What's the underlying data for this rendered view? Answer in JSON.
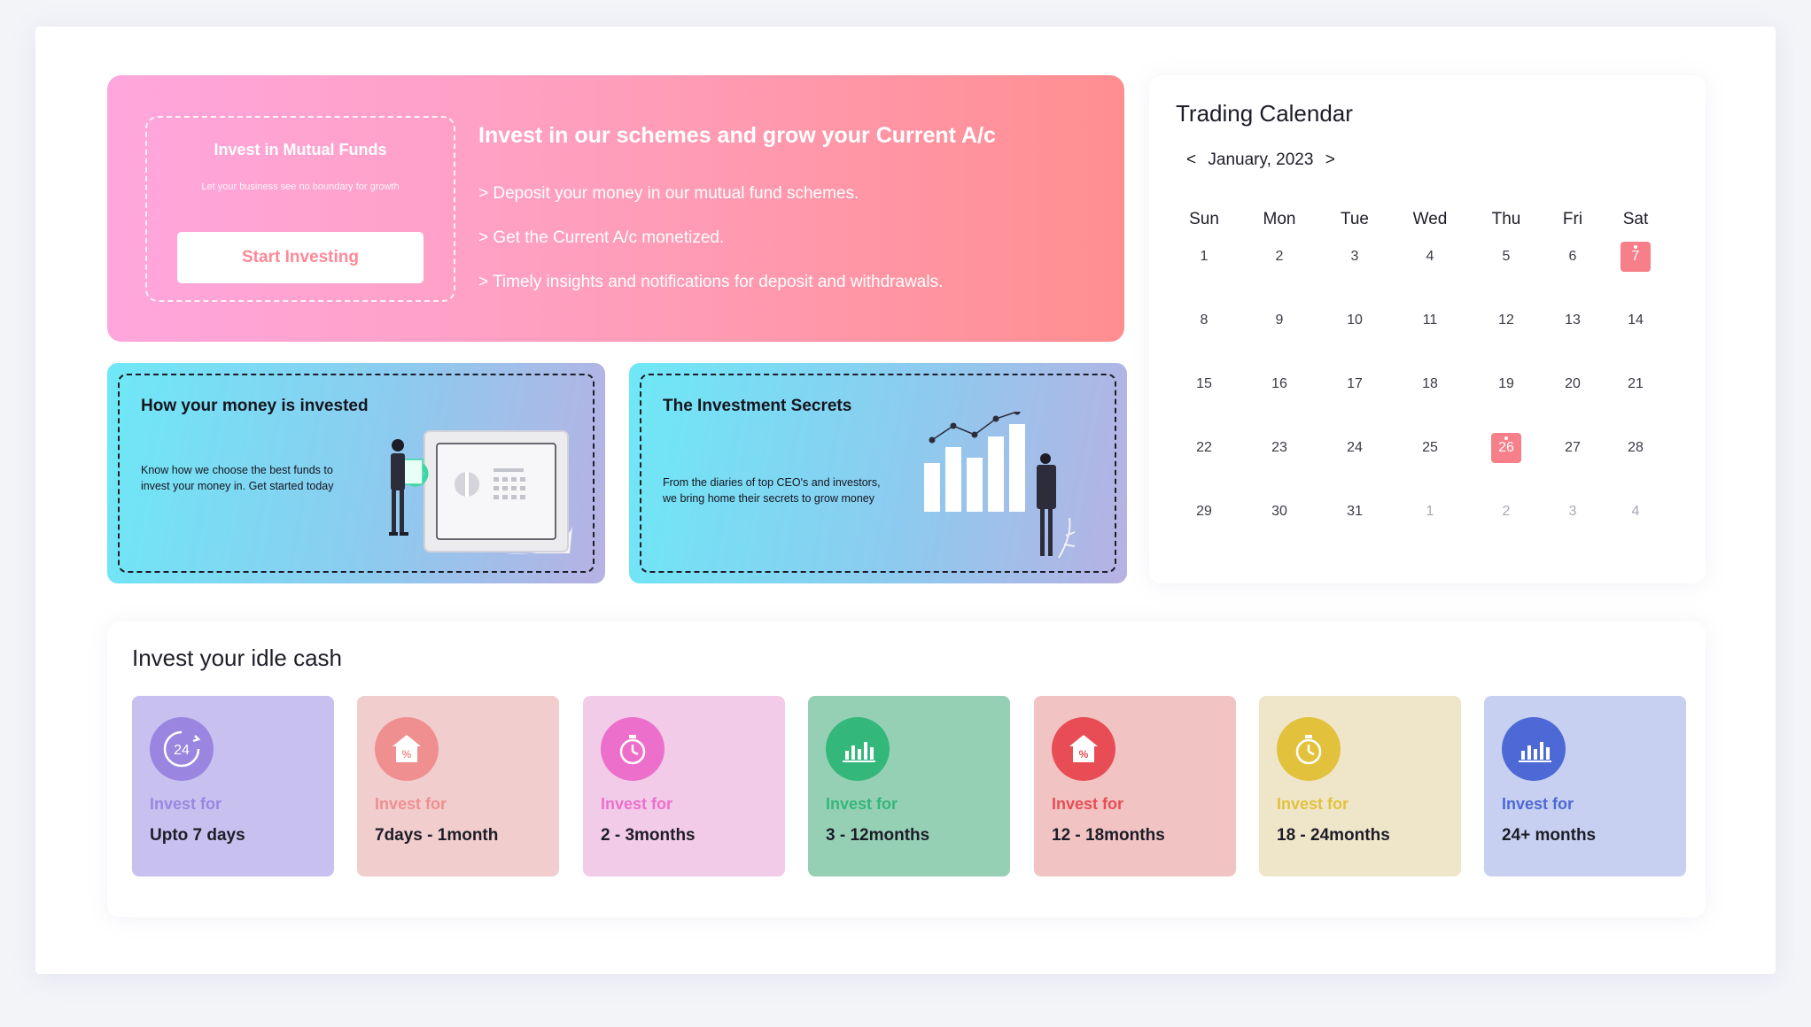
{
  "hero": {
    "box_title": "Invest in Mutual Funds",
    "box_sub": "Let your business see no boundary for growth",
    "cta": "Start Investing",
    "heading": "Invest in our schemes and grow your Current A/c",
    "bullets": [
      "> Deposit your money in our mutual fund schemes.",
      "> Get the Current A/c monetized.",
      "> Timely insights and notifications for deposit and withdrawals."
    ]
  },
  "cards": [
    {
      "title": "How your money is invested",
      "desc": "Know how we choose the best funds to invest your money in. Get started today"
    },
    {
      "title": "The Investment Secrets",
      "desc": "From the diaries of top CEO's and investors, we bring home their secrets to grow money"
    }
  ],
  "calendar": {
    "title": "Trading Calendar",
    "prev": "<",
    "next": ">",
    "month": "January, 2023",
    "weekdays": [
      "Sun",
      "Mon",
      "Tue",
      "Wed",
      "Thu",
      "Fri",
      "Sat"
    ],
    "weeks": [
      [
        "1",
        "2",
        "3",
        "4",
        "5",
        "6",
        "7"
      ],
      [
        "8",
        "9",
        "10",
        "11",
        "12",
        "13",
        "14"
      ],
      [
        "15",
        "16",
        "17",
        "18",
        "19",
        "20",
        "21"
      ],
      [
        "22",
        "23",
        "24",
        "25",
        "26",
        "27",
        "28"
      ],
      [
        "29",
        "30",
        "31",
        "1",
        "2",
        "3",
        "4"
      ]
    ]
  },
  "idle": {
    "title": "Invest your idle cash",
    "tiles": [
      {
        "label": "Invest for",
        "value": "Upto 7 days",
        "icon": "24-hours-icon",
        "accent": "#9a86e0",
        "bg": "#c8c1f0"
      },
      {
        "label": "Invest for",
        "value": "7days - 1month",
        "icon": "percent-house-icon",
        "accent": "#f08f8f",
        "bg": "#f1cdcd"
      },
      {
        "label": "Invest for",
        "value": "2 - 3months",
        "icon": "stopwatch-icon",
        "accent": "#ec6fcb",
        "bg": "#f2cbe8"
      },
      {
        "label": "Invest for",
        "value": "3 - 12months",
        "icon": "bar-chart-icon",
        "accent": "#33b77a",
        "bg": "#96d0b4"
      },
      {
        "label": "Invest for",
        "value": "12 - 18months",
        "icon": "percent-house-icon",
        "accent": "#e84d55",
        "bg": "#f1c3c3"
      },
      {
        "label": "Invest for",
        "value": "18 - 24months",
        "icon": "stopwatch-icon",
        "accent": "#e2c23d",
        "bg": "#efe6c9"
      },
      {
        "label": "Invest for",
        "value": "24+ months",
        "icon": "bar-chart-icon",
        "accent": "#4d69d6",
        "bg": "#c7d0f1"
      }
    ]
  }
}
